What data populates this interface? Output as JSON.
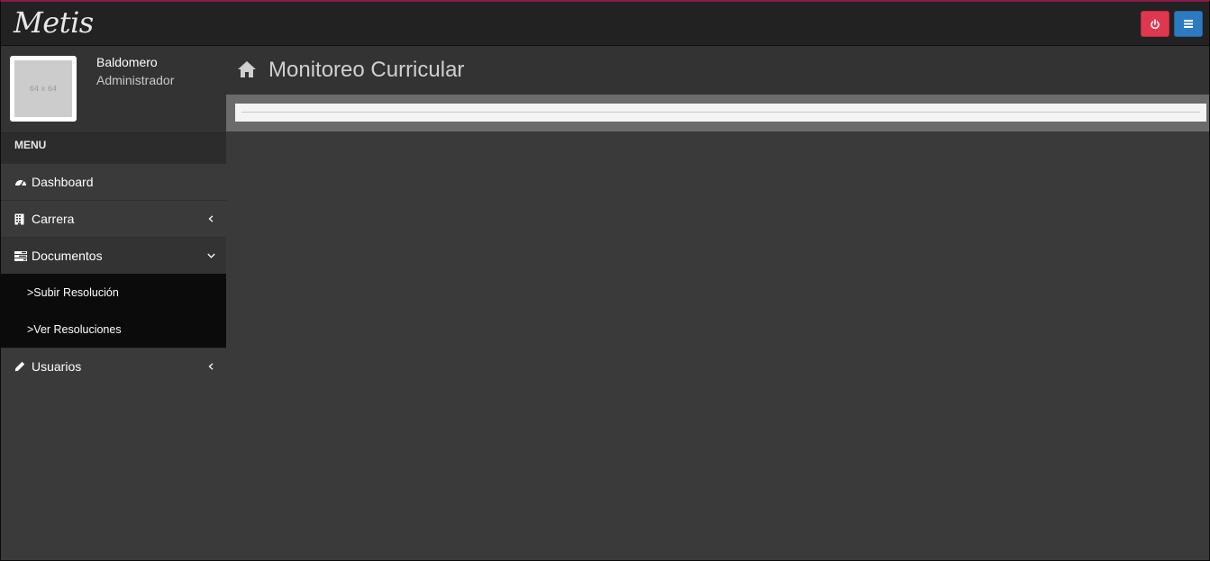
{
  "brand": "Metis",
  "user": {
    "name": "Baldomero",
    "role": "Administrador",
    "avatar_placeholder": "64 x 64"
  },
  "menu": {
    "header": "MENU",
    "items": [
      {
        "label": "Dashboard",
        "icon": "dashboard-icon"
      },
      {
        "label": "Carrera",
        "icon": "building-icon"
      },
      {
        "label": "Documentos",
        "icon": "tasks-icon",
        "open": true,
        "subitems": [
          ">Subir Resolución",
          ">Ver Resoluciones"
        ]
      },
      {
        "label": "Usuarios",
        "icon": "pencil-icon"
      }
    ]
  },
  "page": {
    "title": "Monitoreo Curricular"
  },
  "colors": {
    "power_button": "#e0364f",
    "menu_button": "#2d7ac0",
    "top_border": "#8a1a4a"
  }
}
